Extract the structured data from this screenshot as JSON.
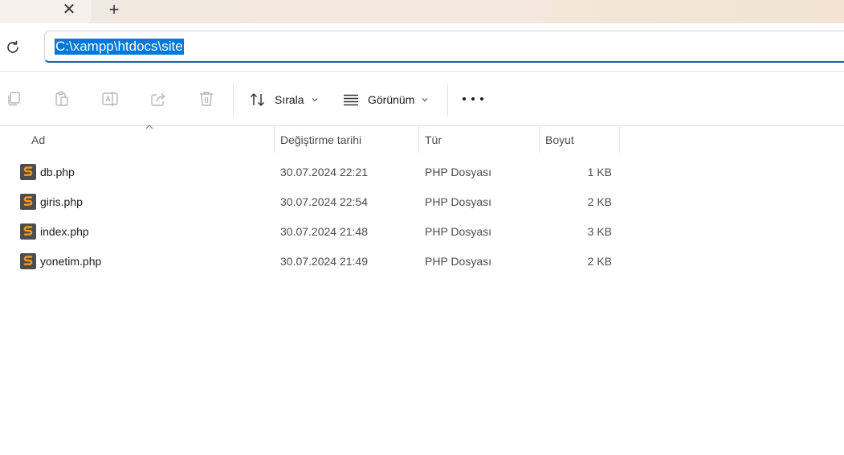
{
  "tabs": {
    "close_glyph": "✕",
    "new_glyph": "+"
  },
  "address": {
    "path": "C:\\xampp\\htdocs\\site",
    "selection_color": "#0078d7"
  },
  "toolbar": {
    "icons": [
      "copy-icon",
      "paste-icon",
      "rename-icon",
      "share-icon",
      "delete-icon"
    ],
    "sort_label": "Sırala",
    "view_label": "Görünüm"
  },
  "columns": {
    "name": "Ad",
    "date": "Değiştirme tarihi",
    "type": "Tür",
    "size": "Boyut"
  },
  "files": [
    {
      "name": "db.php",
      "date": "30.07.2024 22:21",
      "type": "PHP Dosyası",
      "size": "1 KB"
    },
    {
      "name": "giris.php",
      "date": "30.07.2024 22:54",
      "type": "PHP Dosyası",
      "size": "2 KB"
    },
    {
      "name": "index.php",
      "date": "30.07.2024 21:48",
      "type": "PHP Dosyası",
      "size": "3 KB"
    },
    {
      "name": "yonetim.php",
      "date": "30.07.2024 21:49",
      "type": "PHP Dosyası",
      "size": "2 KB"
    }
  ],
  "colors": {
    "accent": "#0067c0",
    "file_icon_bg": "#4d4d4d",
    "file_icon_fg": "#f89820"
  }
}
